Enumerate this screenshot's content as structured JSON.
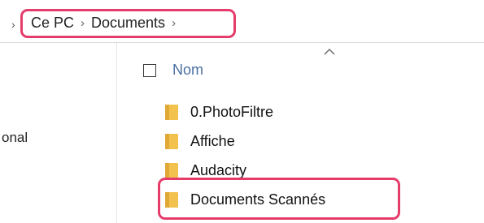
{
  "address_bar": {
    "crumbs": [
      "Ce PC",
      "Documents"
    ]
  },
  "nav_pane": {
    "partial_item": "onal"
  },
  "header": {
    "name_column": "Nom"
  },
  "files": [
    {
      "name": "0.PhotoFiltre"
    },
    {
      "name": "Affiche"
    },
    {
      "name": "Audacity"
    },
    {
      "name": "Documents Scannés"
    }
  ],
  "colors": {
    "highlight": "#e53c6b",
    "folder": "#f2c14e",
    "column_header_text": "#4b6fa3"
  }
}
